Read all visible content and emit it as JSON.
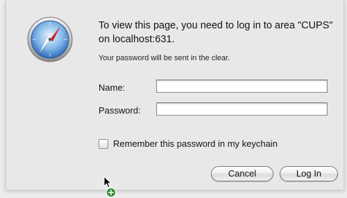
{
  "dialog": {
    "icon": "safari-compass-icon",
    "message": "To view this page, you need to log in to area \"CUPS\" on localhost:631.",
    "note": "Your password will be sent in the clear."
  },
  "form": {
    "name_label": "Name:",
    "name_value": "",
    "password_label": "Password:",
    "password_value": "",
    "remember_label": "Remember this password in my keychain",
    "remember_checked": false
  },
  "buttons": {
    "cancel": "Cancel",
    "login": "Log In"
  },
  "cursor": {
    "icon": "arrow-cursor-with-add-badge-icon"
  }
}
